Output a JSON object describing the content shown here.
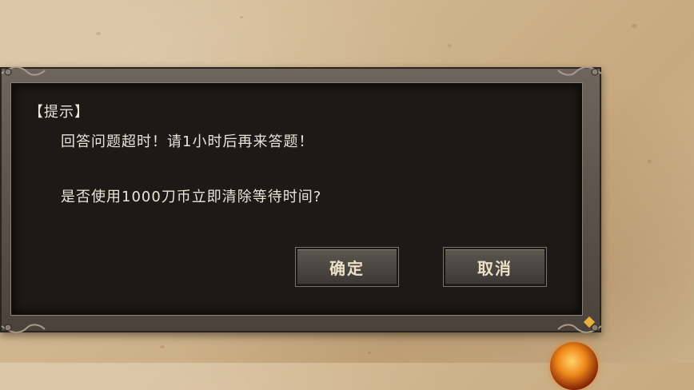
{
  "dialog": {
    "title": "【提示】",
    "message_line1": "回答问题超时！请1小时后再来答题！",
    "message_line2": "是否使用1000刀币立即清除等待时间?",
    "confirm_label": "确定",
    "cancel_label": "取消"
  },
  "colors": {
    "panel_bg": "#1d1916",
    "frame": "#5a524b",
    "text": "#ece4d8",
    "button_text": "#ece0c6",
    "parchment": "#cfb48c"
  },
  "icons": {
    "corner_ornament": "ornate-corner-icon",
    "orb": "fire-orb-icon"
  }
}
